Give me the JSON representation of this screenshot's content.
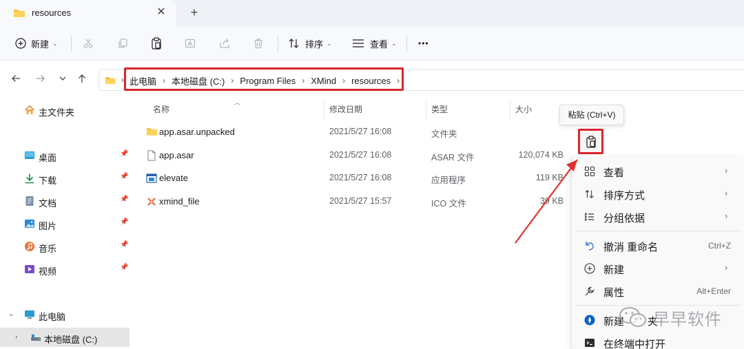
{
  "tab": {
    "title": "resources",
    "close": "✕",
    "new_tab": "+"
  },
  "toolbar": {
    "new_label": "新建",
    "sort_label": "排序",
    "view_label": "查看",
    "more_label": "•••"
  },
  "address": {
    "crumbs": [
      "此电脑",
      "本地磁盘 (C:)",
      "Program Files",
      "XMind",
      "resources"
    ],
    "separator": "›"
  },
  "sidebar": {
    "home": "主文件夹",
    "quick_access": [
      "桌面",
      "下载",
      "文档",
      "图片",
      "音乐",
      "视频"
    ],
    "this_pc": "此电脑",
    "local_disk": "本地磁盘 (C:)"
  },
  "filelist": {
    "columns": {
      "name": "名称",
      "date": "修改日期",
      "type": "类型",
      "size": "大小"
    },
    "rows": [
      {
        "name": "app.asar.unpacked",
        "date": "2021/5/27 16:08",
        "type": "文件夹",
        "size": "",
        "icon": "folder-icon"
      },
      {
        "name": "app.asar",
        "date": "2021/5/27 16:08",
        "type": "ASAR 文件",
        "size": "120,074 KB",
        "icon": "file-icon"
      },
      {
        "name": "elevate",
        "date": "2021/5/27 16:08",
        "type": "应用程序",
        "size": "119 KB",
        "icon": "app-icon"
      },
      {
        "name": "xmind_file",
        "date": "2021/5/27 15:57",
        "type": "ICO 文件",
        "size": "39 KB",
        "icon": "xmind-icon"
      }
    ]
  },
  "tooltip": {
    "text": "粘贴 (Ctrl+V)"
  },
  "context_menu": {
    "view": "查看",
    "sort_by": "排序方式",
    "group_by": "分组依据",
    "undo": "撤消 重命名",
    "undo_key": "Ctrl+Z",
    "new": "新建",
    "properties": "属性",
    "properties_key": "Alt+Enter",
    "new_folder_partial": "新建",
    "new_folder_tail": "夹",
    "open_terminal": "在终端中打开",
    "submenu_arrow": "›"
  },
  "watermark": {
    "text": "早早软件"
  },
  "colors": {
    "highlight_red": "#d9262c",
    "folder_yellow": "#f4c342",
    "accent_blue": "#0a64c8"
  }
}
